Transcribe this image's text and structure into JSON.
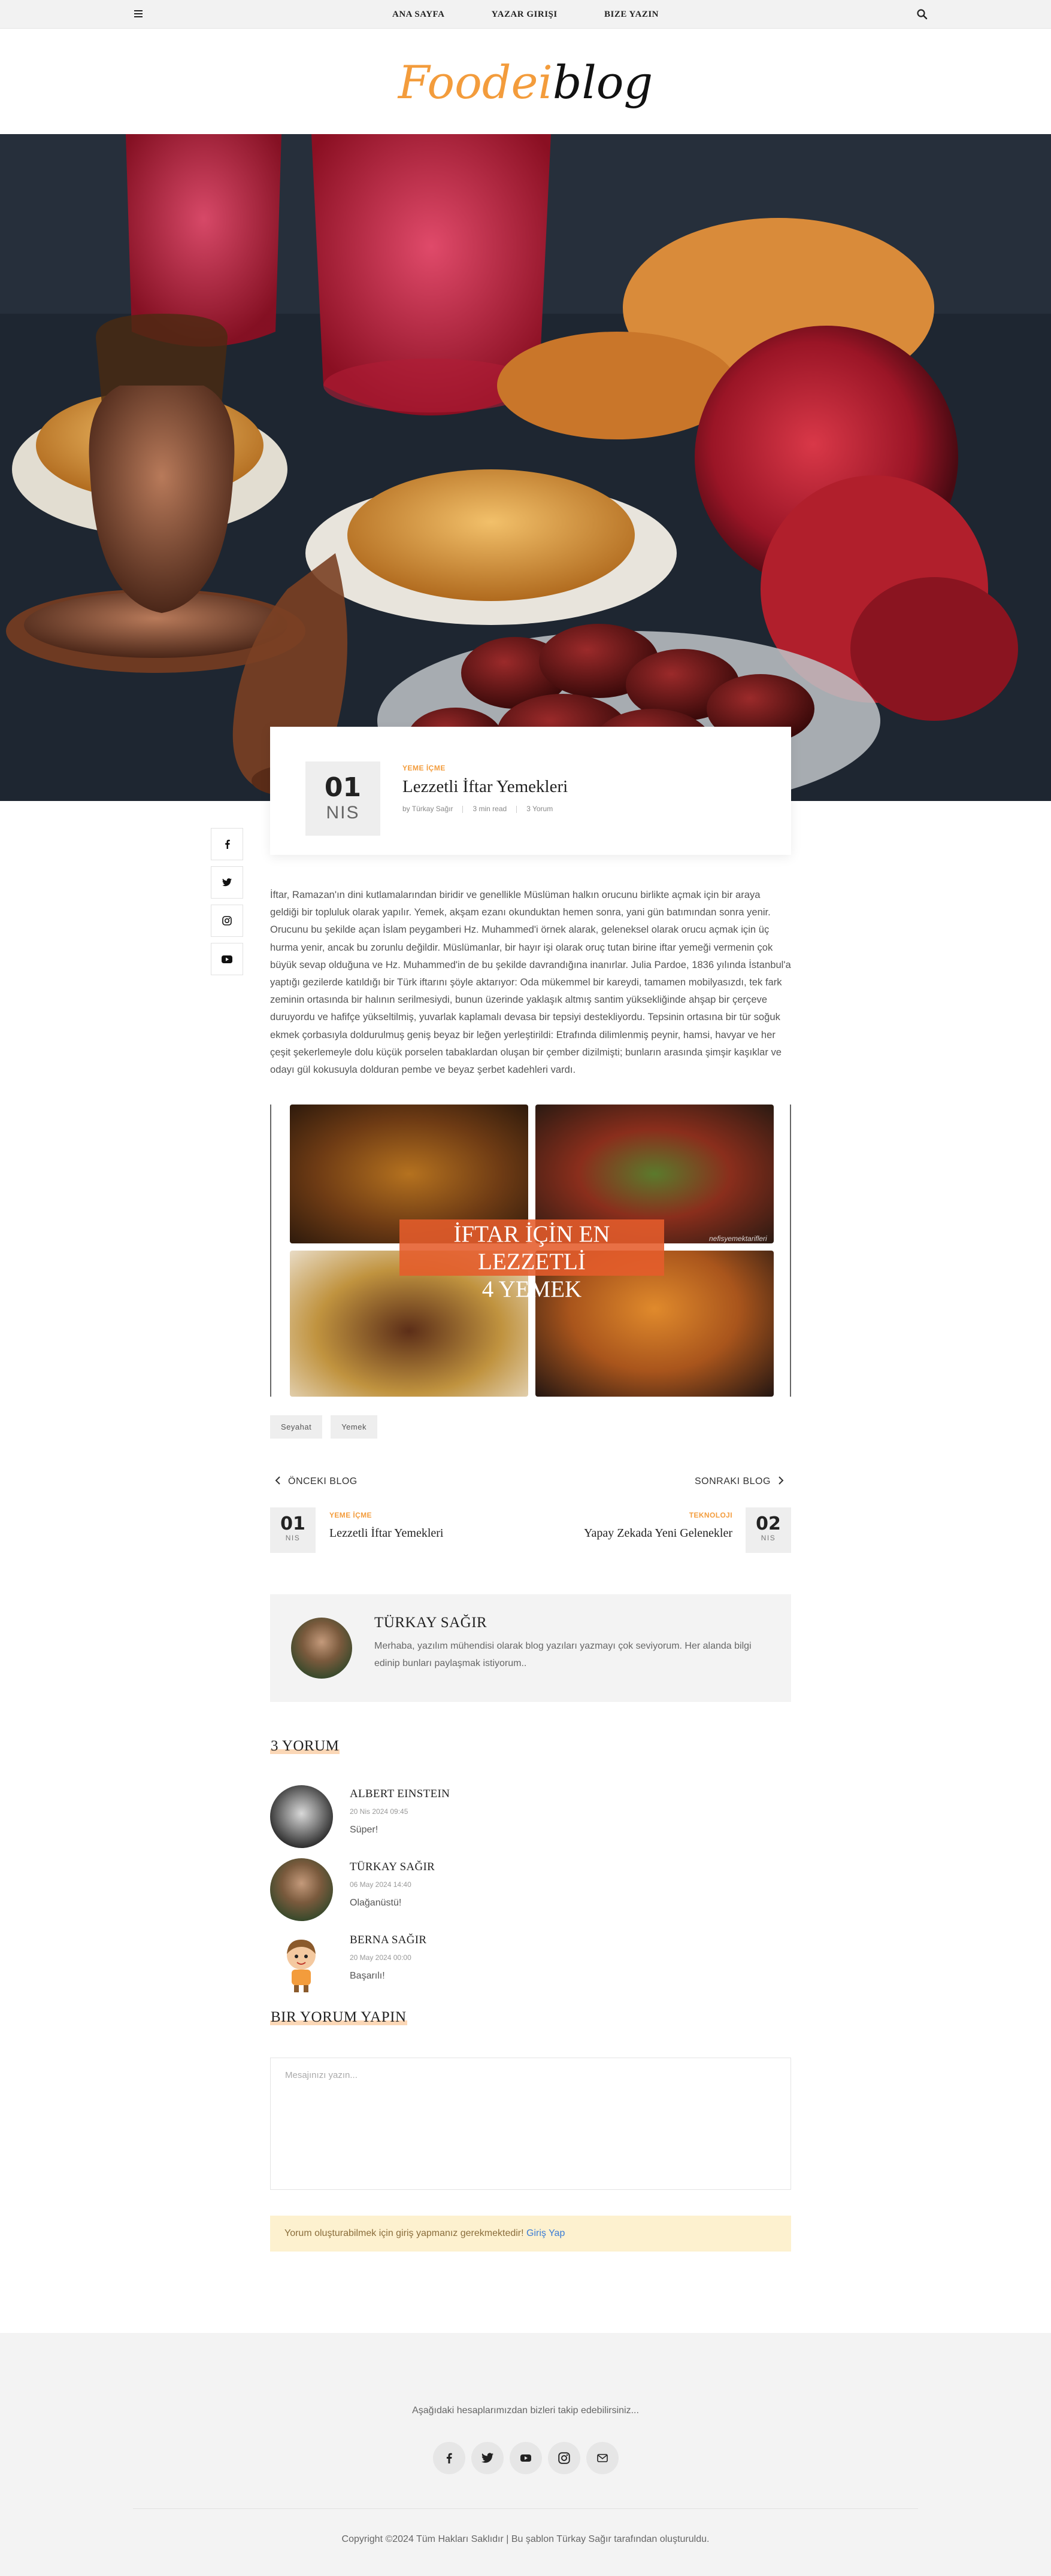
{
  "nav": {
    "items": [
      "ANA SAYFA",
      "YAZAR GIRIŞI",
      "BIZE YAZIN"
    ],
    "menu_icon": "hamburger-icon",
    "search_icon": "search-icon"
  },
  "logo": {
    "part1": "Foodei",
    "part2": "blog",
    "accent": "#f39c3c"
  },
  "post": {
    "date_day": "01",
    "date_month": "NIS",
    "category": "YEME İÇME",
    "title": "Lezzetli İftar Yemekleri",
    "author": "by Türkay Sağır",
    "read_time": "3 min read",
    "comments": "3 Yorum",
    "body": "İftar, Ramazan'ın dini kutlamalarından biridir ve genellikle Müslüman halkın orucunu birlikte açmak için bir araya geldiği bir topluluk olarak yapılır. Yemek, akşam ezanı okunduktan hemen sonra, yani gün batımından sonra yenir. Orucunu bu şekilde açan İslam peygamberi Hz. Muhammed'i örnek alarak, geleneksel olarak orucu açmak için üç hurma yenir, ancak bu zorunlu değildir. Müslümanlar, bir hayır işi olarak oruç tutan birine iftar yemeği vermenin çok büyük sevap olduğuna ve Hz. Muhammed'in de bu şekilde davrandığına inanırlar. Julia Pardoe, 1836 yılında İstanbul'a yaptığı gezilerde katıldığı bir Türk iftarını şöyle aktarıyor: Oda mükemmel bir kareydi, tamamen mobilyasızdı, tek fark zeminin ortasında bir halının serilmesiydi, bunun üzerinde yaklaşık altmış santim yüksekliğinde ahşap bir çerçeve duruyordu ve hafifçe yükseltilmiş, yuvarlak kaplamalı devasa bir tepsiyi destekliyordu. Tepsinin ortasına bir tür soğuk ekmek çorbasıyla doldurulmuş geniş beyaz bir leğen yerleştirildi: Etrafında dilimlenmiş peynir, hamsi, havyar ve her çeşit şekerlemeyle dolu küçük porselen tabaklardan oluşan bir çember dizilmişti; bunların arasında şimşir kaşıklar ve odayı gül kokusuyla dolduran pembe ve beyaz şerbet kadehleri vardı.",
    "image_banner_line1": "İFTAR İÇİN EN LEZZETLİ",
    "image_banner_line2": "4 YEMEK",
    "image_watermark": "nefisyemektarifleri",
    "tags": [
      "Seyahat",
      "Yemek"
    ]
  },
  "share": [
    "facebook-icon",
    "twitter-icon",
    "instagram-icon",
    "youtube-icon"
  ],
  "prev": {
    "label": "ÖNCEKI BLOG",
    "day": "01",
    "month": "NIS",
    "category": "YEME İÇME",
    "title": "Lezzetli İftar Yemekleri"
  },
  "next": {
    "label": "SONRAKI BLOG",
    "day": "02",
    "month": "NIS",
    "category": "TEKNOLOJI",
    "title": "Yapay Zekada Yeni Gelenekler"
  },
  "author_box": {
    "name": "TÜRKAY SAĞIR",
    "bio": "Merhaba, yazılım mühendisi olarak blog yazıları yazmayı çok seviyorum. Her alanda bilgi edinip bunları paylaşmak istiyorum.."
  },
  "comments": {
    "title": "3 YORUM",
    "items": [
      {
        "name": "ALBERT EINSTEIN",
        "date": "20 Nis 2024 09:45",
        "text": "Süper!"
      },
      {
        "name": "TÜRKAY SAĞIR",
        "date": "06 May 2024 14:40",
        "text": "Olağanüstü!"
      },
      {
        "name": "BERNA SAĞIR",
        "date": "20 May 2024 00:00",
        "text": "Başarılı!"
      }
    ]
  },
  "form": {
    "title": "BIR YORUM YAPIN",
    "placeholder": "Mesajınızı yazın...",
    "notice": "Yorum oluşturabilmek için giriş yapmanız gerekmektedir!",
    "login_link": "Giriş Yap"
  },
  "footer": {
    "follow_text": "Aşağıdaki hesaplarımızdan bizleri takip edebilirsiniz...",
    "social": [
      "facebook-icon",
      "twitter-icon",
      "youtube-icon",
      "instagram-icon",
      "mail-icon"
    ],
    "copyright": "Copyright ©2024 Tüm Hakları Saklıdır | Bu şablon Türkay Sağır tarafından oluşturuldu."
  }
}
